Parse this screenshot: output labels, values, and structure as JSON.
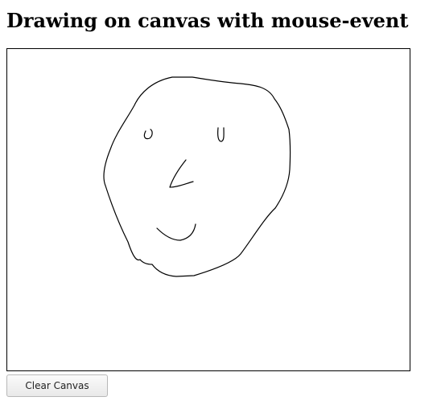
{
  "page": {
    "title": "Drawing on canvas with mouse-event"
  },
  "canvas": {
    "stroke_color": "#000000",
    "background_color": "#ffffff"
  },
  "controls": {
    "clear_label": "Clear Canvas"
  }
}
